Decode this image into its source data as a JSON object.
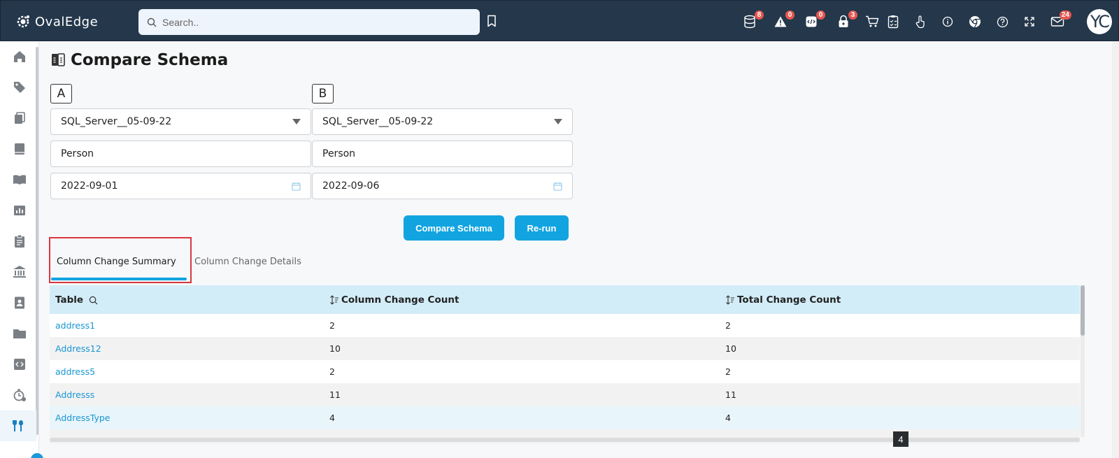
{
  "app": {
    "brand": "OvalEdge"
  },
  "search": {
    "placeholder": "Search.."
  },
  "header_icons": [
    {
      "name": "database-icon",
      "badge": "8"
    },
    {
      "name": "alert-icon",
      "badge": "0"
    },
    {
      "name": "code-task-icon",
      "badge": "0"
    },
    {
      "name": "lock-icon",
      "badge": "3"
    },
    {
      "name": "cart-icon",
      "badge": ""
    },
    {
      "name": "checklist-icon",
      "badge": ""
    },
    {
      "name": "touch-icon",
      "badge": ""
    },
    {
      "name": "info-icon",
      "badge": ""
    },
    {
      "name": "chrome-icon",
      "badge": ""
    },
    {
      "name": "help-icon",
      "badge": ""
    },
    {
      "name": "expand-icon",
      "badge": ""
    },
    {
      "name": "mail-icon",
      "badge": "24"
    }
  ],
  "avatar": {
    "initials": "YC"
  },
  "page": {
    "title": "Compare Schema"
  },
  "schema_a": {
    "label": "A",
    "connection": "SQL_Server__05-09-22",
    "schema": "Person",
    "date": "2022-09-01"
  },
  "schema_b": {
    "label": "B",
    "connection": "SQL_Server__05-09-22",
    "schema": "Person",
    "date": "2022-09-06"
  },
  "actions": {
    "compare_label": "Compare Schema",
    "rerun_label": "Re-run"
  },
  "tabs": [
    {
      "label": "Column Change Summary",
      "active": true
    },
    {
      "label": "Column Change Details",
      "active": false
    }
  ],
  "table": {
    "headers": [
      "Table",
      "Column Change Count",
      "Total Change Count"
    ],
    "rows": [
      {
        "table": "address1",
        "column_changes": "2",
        "total_changes": "2"
      },
      {
        "table": "Address12",
        "column_changes": "10",
        "total_changes": "10"
      },
      {
        "table": "address5",
        "column_changes": "2",
        "total_changes": "2"
      },
      {
        "table": "Addresss",
        "column_changes": "11",
        "total_changes": "11"
      },
      {
        "table": "AddressType",
        "column_changes": "4",
        "total_changes": "4"
      }
    ]
  },
  "pagination": {
    "page_badge": "4"
  },
  "colors": {
    "accent": "#12a4e0",
    "header_bg": "#24374b",
    "highlight": "#d9373f",
    "table_header": "#d3edf8",
    "badge": "#e5574f"
  }
}
